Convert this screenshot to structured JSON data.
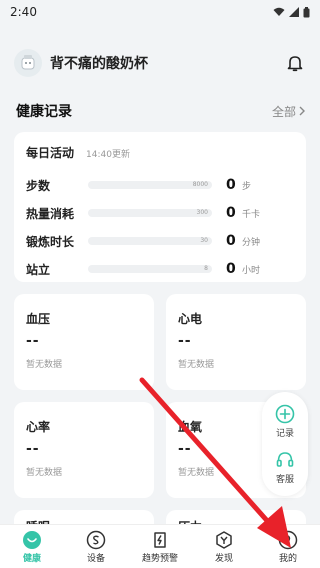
{
  "status_bar": {
    "time": "2:40"
  },
  "header": {
    "username": "背不痛的酸奶杯"
  },
  "section": {
    "title": "健康记录",
    "see_all": "全部"
  },
  "activity": {
    "title": "每日活动",
    "updated": "14:40更新",
    "metrics": [
      {
        "label": "步数",
        "goal": "8000",
        "value": "0",
        "unit": "步"
      },
      {
        "label": "热量消耗",
        "goal": "300",
        "value": "0",
        "unit": "千卡"
      },
      {
        "label": "锻炼时长",
        "goal": "30",
        "value": "0",
        "unit": "分钟"
      },
      {
        "label": "站立",
        "goal": "8",
        "value": "0",
        "unit": "小时"
      }
    ]
  },
  "cards": [
    {
      "title": "血压",
      "value": "--",
      "empty": "暂无数据"
    },
    {
      "title": "心电",
      "value": "--",
      "empty": "暂无数据"
    },
    {
      "title": "心率",
      "value": "--",
      "empty": "暂无数据"
    },
    {
      "title": "血氧",
      "value": "--",
      "empty": "暂无数据"
    },
    {
      "title": "睡眠",
      "value": "",
      "empty": ""
    },
    {
      "title": "压力",
      "value": "",
      "empty": ""
    }
  ],
  "float_panel": {
    "record_label": "记录",
    "service_label": "客服"
  },
  "nav": [
    {
      "label": "健康",
      "icon": "health-icon",
      "active": true
    },
    {
      "label": "设备",
      "icon": "device-icon",
      "active": false
    },
    {
      "label": "趋势预警",
      "icon": "trend-alert-icon",
      "active": false
    },
    {
      "label": "发现",
      "icon": "discover-icon",
      "active": false
    },
    {
      "label": "我的",
      "icon": "profile-icon",
      "active": false
    }
  ],
  "colors": {
    "accent": "#35c4a8",
    "arrow": "#e8222a",
    "background": "#f2f4f6"
  }
}
